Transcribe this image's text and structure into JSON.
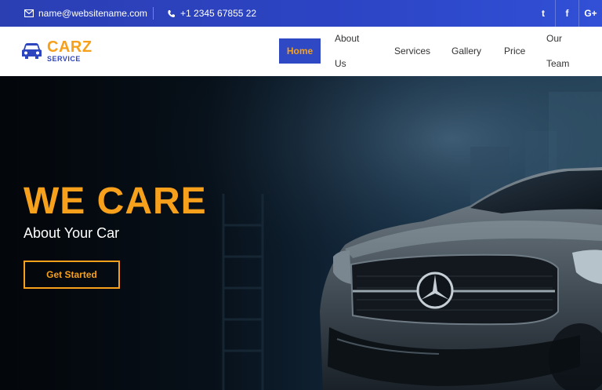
{
  "topbar": {
    "email": "name@websitename.com",
    "phone": "+1 2345 67855 22",
    "social": [
      {
        "icon": "twitter-icon",
        "glyph": "t"
      },
      {
        "icon": "facebook-icon",
        "glyph": "f"
      },
      {
        "icon": "google-plus-icon",
        "glyph": "G+"
      }
    ]
  },
  "logo": {
    "brand": "CARZ",
    "subtitle": "SERVICE"
  },
  "nav": {
    "items": [
      "Home",
      "About Us",
      "Services",
      "Gallery",
      "Price",
      "Our Team"
    ],
    "active": "Home"
  },
  "hero": {
    "headline": "WE CARE",
    "subheadline": "About Your Car",
    "cta_label": "Get Started"
  },
  "colors": {
    "accent": "#f6a01b",
    "brand_blue": "#2f48c3",
    "topbar_start": "#2b3fb3",
    "topbar_end": "#3150d6"
  }
}
